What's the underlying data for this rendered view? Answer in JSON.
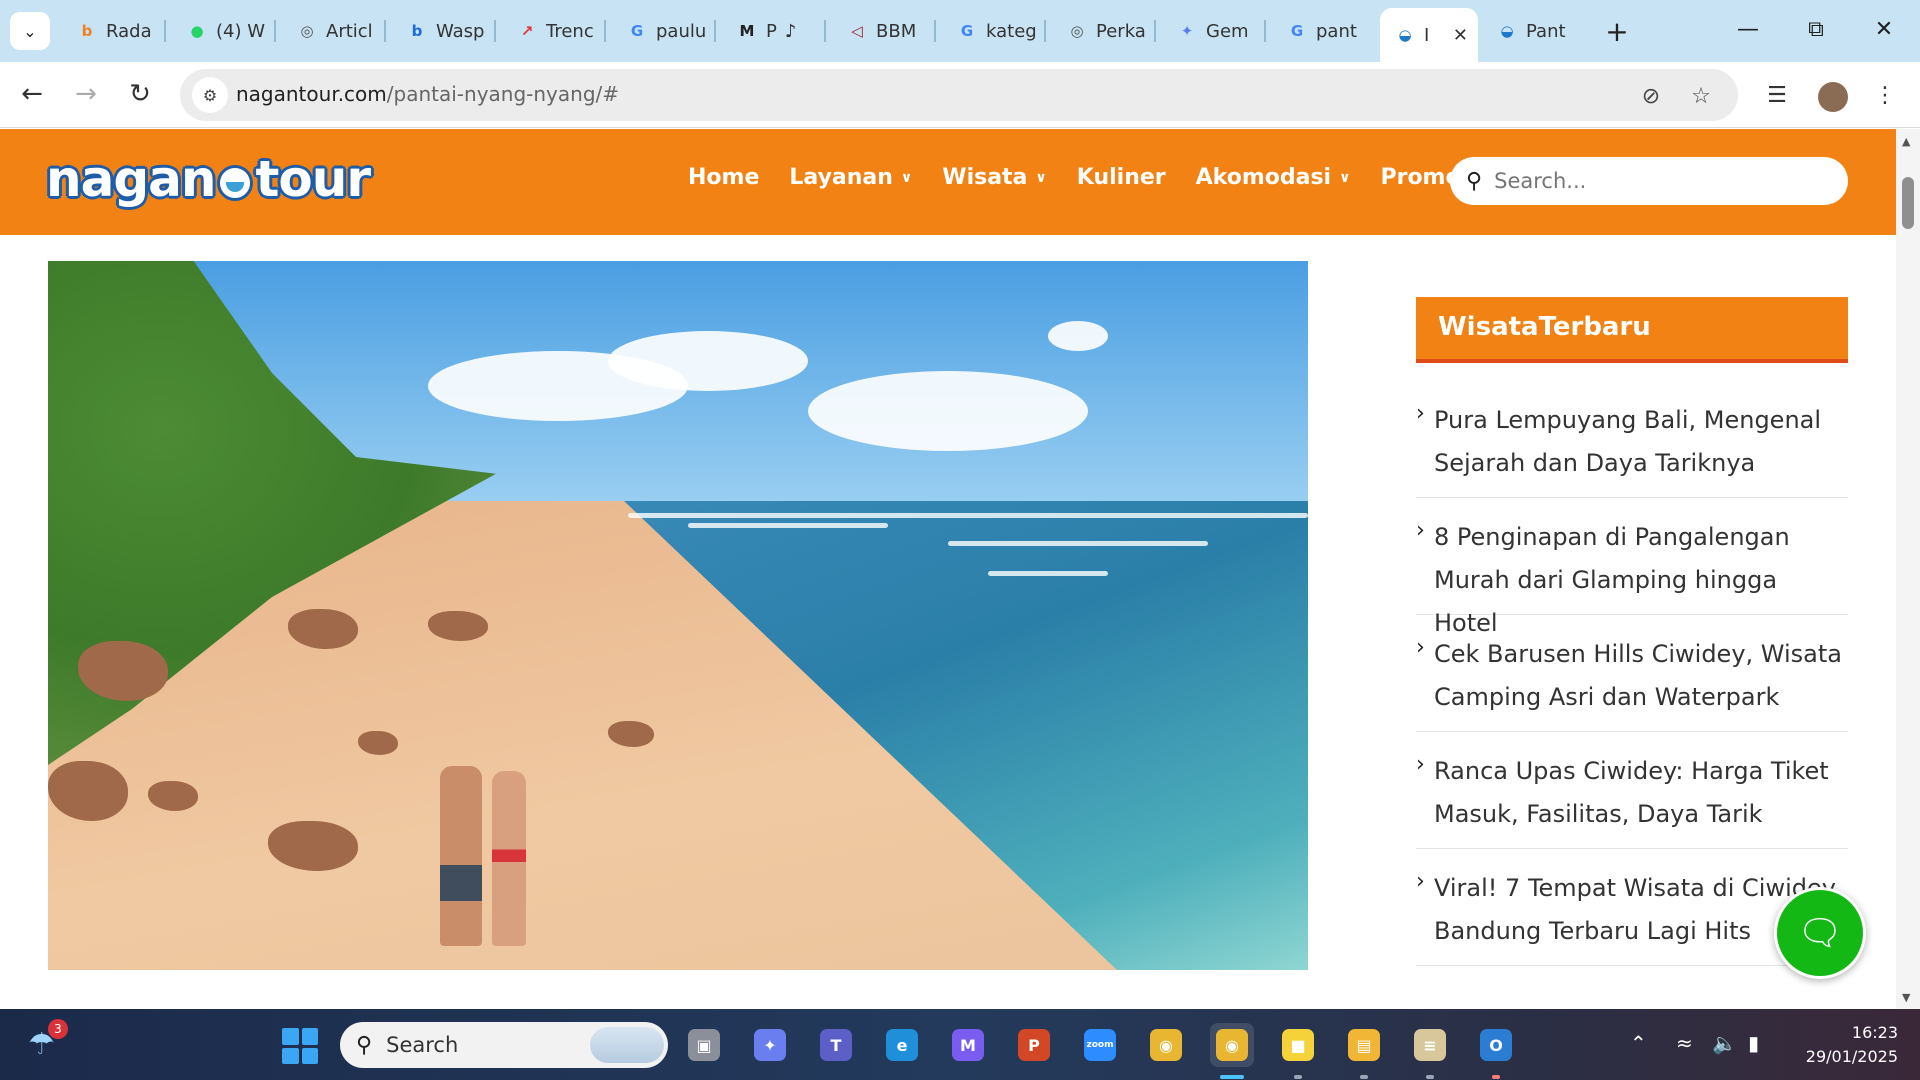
{
  "browser": {
    "tabs": [
      {
        "title": "Rada",
        "icon": "bing-icon",
        "color": "#f08022"
      },
      {
        "title": "(4) W",
        "icon": "whatsapp-icon",
        "color": "#25d366"
      },
      {
        "title": "Articl",
        "icon": "globe-icon",
        "color": "#555555"
      },
      {
        "title": "Wasp",
        "icon": "bing-icon",
        "color": "#1e6be0"
      },
      {
        "title": "Trenc",
        "icon": "trends-icon",
        "color": "#e0393e"
      },
      {
        "title": "paulu",
        "icon": "google-icon",
        "color": "#4285f4"
      },
      {
        "title": "P",
        "icon": "mi-icon",
        "color": "#222222"
      },
      {
        "title": "BBM",
        "icon": "bbm-icon",
        "color": "#9b1b30"
      },
      {
        "title": "kateg",
        "icon": "google-icon",
        "color": "#4285f4"
      },
      {
        "title": "Perka",
        "icon": "globe-icon",
        "color": "#555555"
      },
      {
        "title": "Gem",
        "icon": "gemini-icon",
        "color": "#5b7cf0"
      },
      {
        "title": "pant",
        "icon": "google-icon",
        "color": "#4285f4"
      },
      {
        "title": "I",
        "icon": "nagantour-icon",
        "color": "#1e78c8"
      },
      {
        "title": "Pant",
        "icon": "nagantour-icon",
        "color": "#1e78c8"
      }
    ],
    "url_domain": "nagantour.com",
    "url_path": "/pantai-nyang-nyang/#"
  },
  "site": {
    "logo_left": "nagan",
    "logo_right": "tour",
    "menu": [
      {
        "label": "Home",
        "dropdown": false
      },
      {
        "label": "Layanan",
        "dropdown": true
      },
      {
        "label": "Wisata",
        "dropdown": true
      },
      {
        "label": "Kuliner",
        "dropdown": false
      },
      {
        "label": "Akomodasi",
        "dropdown": true
      },
      {
        "label": "Promo",
        "dropdown": false
      }
    ],
    "search_placeholder": "Search...",
    "accent_color": "#f28213"
  },
  "sidebar": {
    "widget_title": "WisataTerbaru",
    "posts": [
      "Pura Lempuyang Bali, Mengenal Sejarah dan Daya Tariknya",
      "8 Penginapan di Pangalengan Murah dari Glamping hingga Hotel",
      "Cek Barusen Hills Ciwidey, Wisata Camping Asri dan Waterpark",
      "Ranca Upas Ciwidey: Harga Tiket Masuk, Fasilitas, Daya Tarik",
      "Viral! 7 Tempat Wisata di Ciwidey Bandung Terbaru Lagi Hits"
    ]
  },
  "taskbar": {
    "weather_badge": "3",
    "search_label": "Search",
    "apps": [
      "task-view",
      "copilot",
      "teams",
      "edge",
      "m365",
      "powerpoint",
      "zoom",
      "chrome",
      "chrome-profile",
      "sticky-notes",
      "file-explorer",
      "reader",
      "outlook"
    ],
    "time": "16:23",
    "date": "29/01/2025"
  }
}
